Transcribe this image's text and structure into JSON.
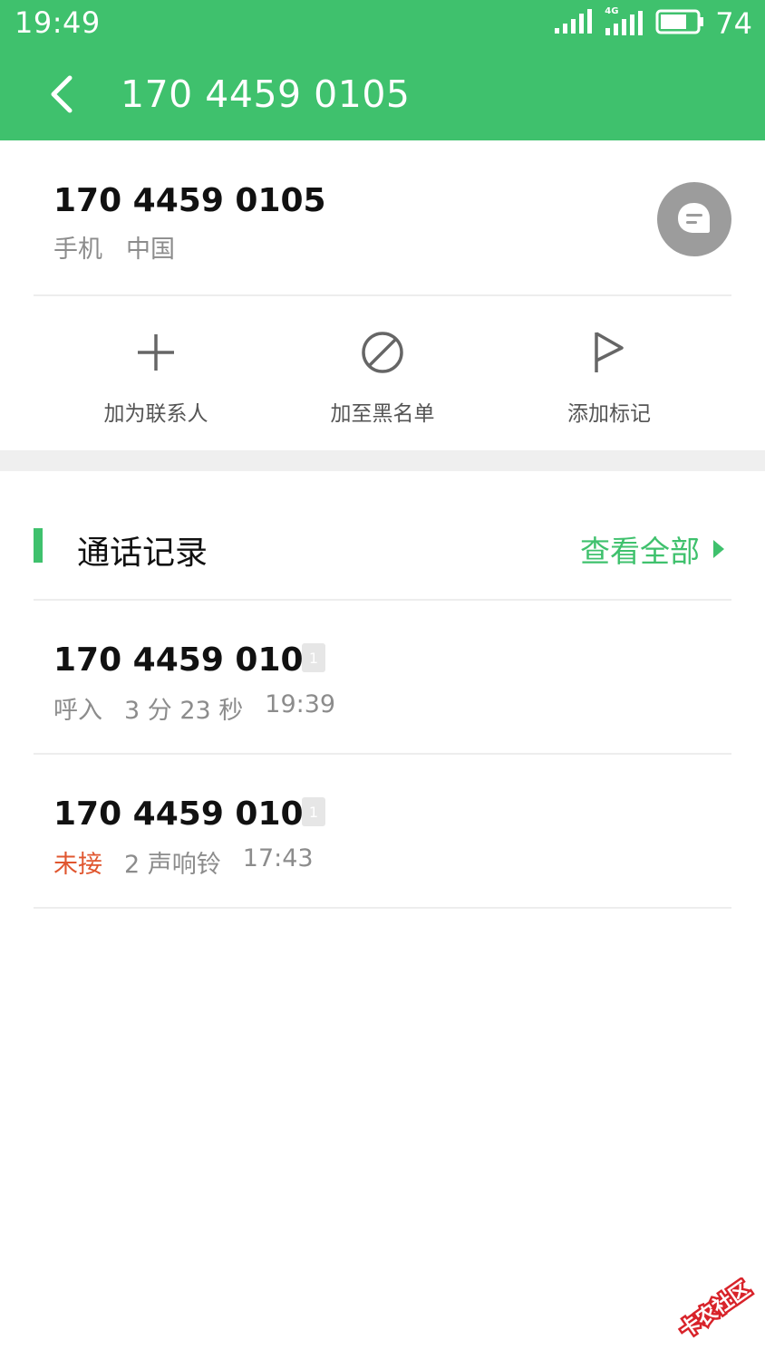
{
  "status_bar": {
    "time": "19:49",
    "network_label": "4G",
    "battery_percent": "74",
    "battery_level": 0.74
  },
  "header": {
    "title": "170 4459 0105",
    "back_icon": "chevron-left-icon"
  },
  "contact": {
    "number": "170 4459 0105",
    "type": "手机",
    "region": "中国",
    "message_icon": "message-bubble-icon"
  },
  "actions": [
    {
      "label": "加为联系人",
      "icon": "plus-icon"
    },
    {
      "label": "加至黑名单",
      "icon": "block-icon"
    },
    {
      "label": "添加标记",
      "icon": "flag-icon"
    }
  ],
  "call_log": {
    "title": "通话记录",
    "view_all": "查看全部",
    "entries": [
      {
        "number": "170 4459 0105",
        "sim": "1",
        "status": "呼入",
        "detail": "3 分 23 秒",
        "time": "19:39",
        "missed": false
      },
      {
        "number": "170 4459 0105",
        "sim": "1",
        "status": "未接",
        "detail": "2 声响铃",
        "time": "17:43",
        "missed": true
      }
    ]
  },
  "colors": {
    "accent": "#3fc16d",
    "missed": "#e0562f",
    "secondary_text": "#8c8c8c"
  },
  "watermark": {
    "text": "卡农社区"
  }
}
